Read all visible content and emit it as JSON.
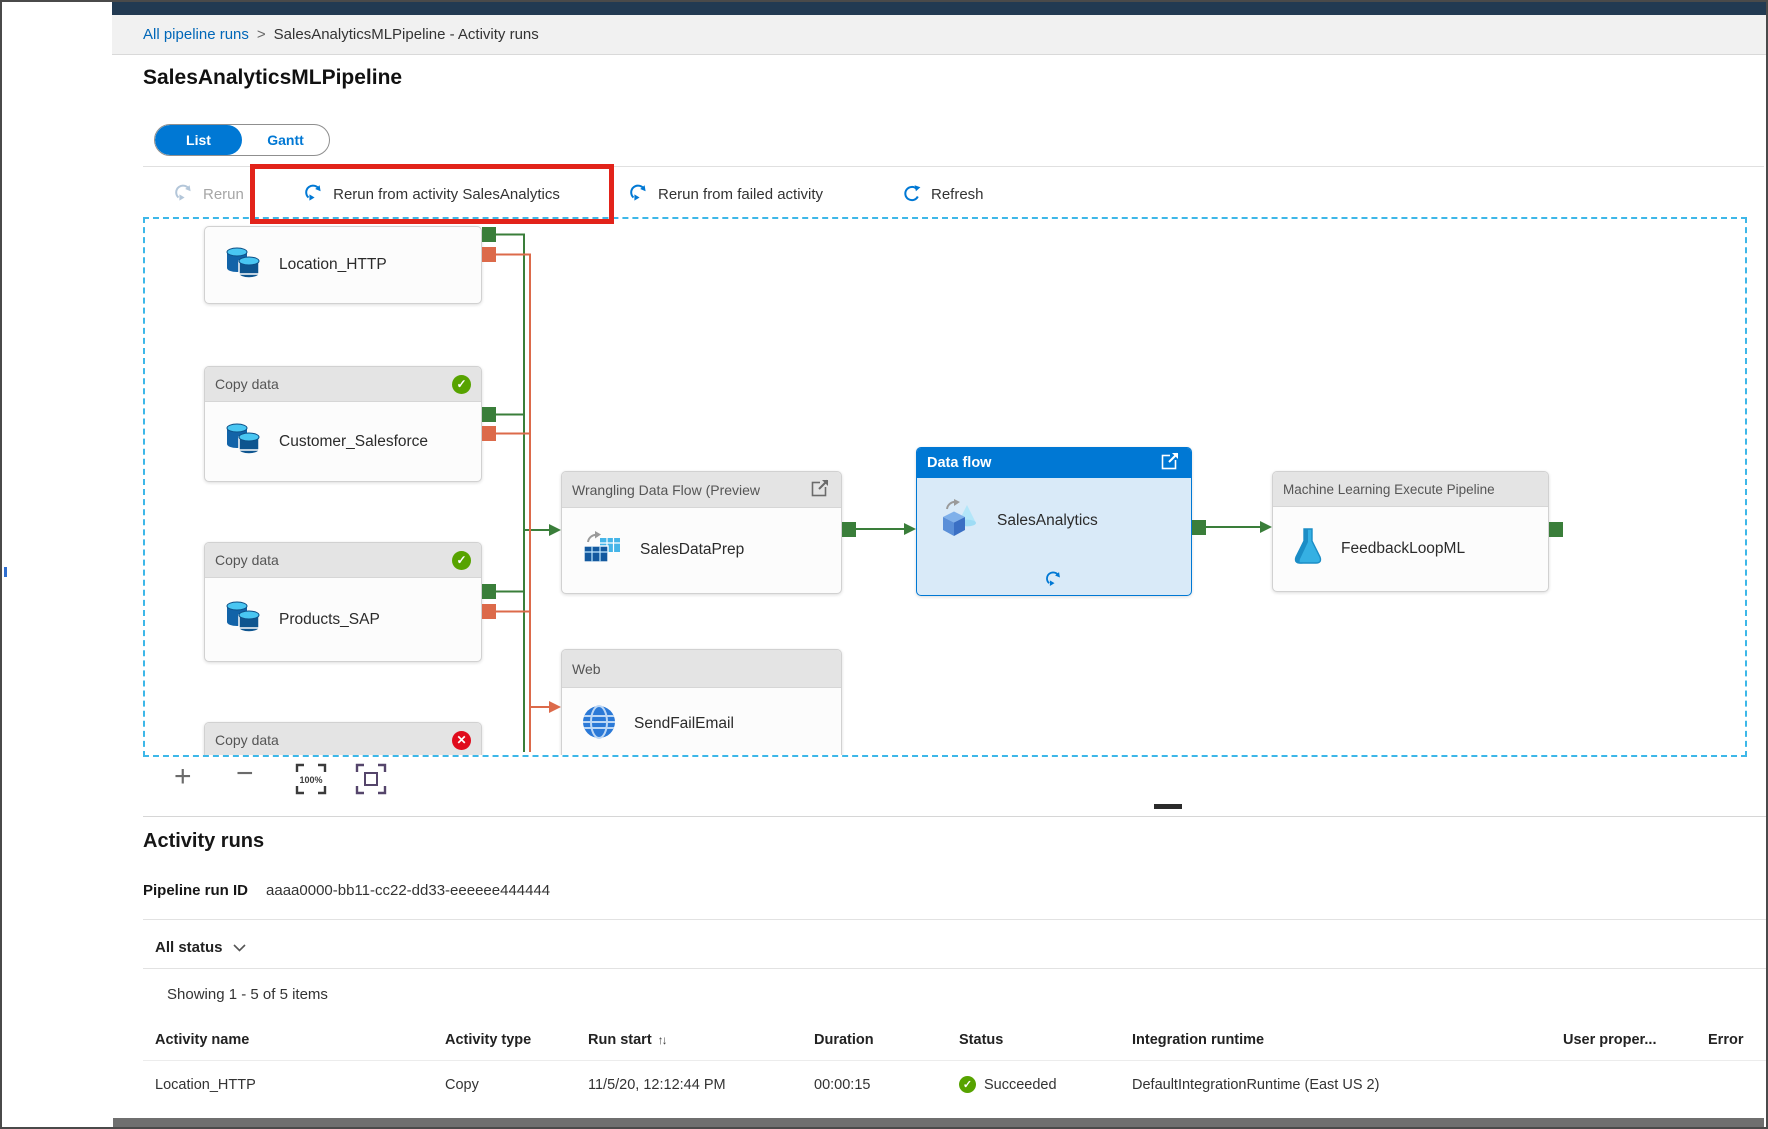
{
  "breadcrumb": {
    "link": "All pipeline runs",
    "separator": ">",
    "current": "SalesAnalyticsMLPipeline - Activity runs"
  },
  "page": {
    "title": "SalesAnalyticsMLPipeline"
  },
  "view_toggle": {
    "list": "List",
    "gantt": "Gantt"
  },
  "toolbar": {
    "rerun": "Rerun",
    "rerun_from_activity": "Rerun from activity SalesAnalytics",
    "rerun_from_failed": "Rerun from failed activity",
    "refresh": "Refresh"
  },
  "canvas": {
    "nodes": {
      "location_http": {
        "name": "Location_HTTP"
      },
      "customer_salesforce": {
        "type": "Copy data",
        "name": "Customer_Salesforce"
      },
      "products_sap": {
        "type": "Copy data",
        "name": "Products_SAP"
      },
      "failed_copy": {
        "type": "Copy data"
      },
      "sales_data_prep": {
        "type": "Wrangling Data Flow (Preview",
        "name": "SalesDataPrep"
      },
      "sales_analytics": {
        "type": "Data flow",
        "name": "SalesAnalytics"
      },
      "feedback_loop": {
        "type": "Machine Learning Execute Pipeline",
        "name": "FeedbackLoopML"
      },
      "send_fail_email": {
        "type": "Web",
        "name": "SendFailEmail"
      }
    },
    "zoom_controls": {
      "zoom_label": "100%"
    }
  },
  "activity_runs": {
    "heading": "Activity runs",
    "pipeline_run_id_label": "Pipeline run ID",
    "pipeline_run_id": "aaaa0000-bb11-cc22-dd33-eeeeee444444",
    "status_filter": "All status",
    "showing": "Showing 1 - 5 of 5 items",
    "table": {
      "headers": [
        "Activity name",
        "Activity type",
        "Run start",
        "Duration",
        "Status",
        "Integration runtime",
        "User proper...",
        "Error"
      ],
      "rows": [
        {
          "activity_name": "Location_HTTP",
          "activity_type": "Copy",
          "run_start": "11/5/20, 12:12:44 PM",
          "duration": "00:00:15",
          "status": "Succeeded",
          "integration_runtime": "DefaultIntegrationRuntime (East US 2)"
        }
      ]
    }
  },
  "colors": {
    "accent": "#0078d4",
    "highlight_box": "#e2231a",
    "success": "#57a300",
    "failure": "#e00b1c",
    "connector_success": "#3a7e3a",
    "connector_failure": "#dc6a4a",
    "canvas_selection": "#3db7e8"
  }
}
